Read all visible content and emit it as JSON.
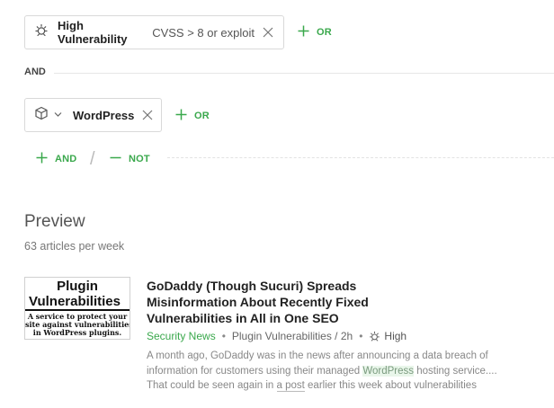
{
  "filters": {
    "row1": {
      "chip_label": "High Vulnerability",
      "chip_detail": "CVSS > 8 or exploit",
      "chip_icon": "vulnerability-icon",
      "or_label": "OR"
    },
    "and_separator": "AND",
    "row2": {
      "chip_label": "WordPress",
      "chip_icon": "cube-icon",
      "or_label": "OR"
    },
    "add_and_label": "AND",
    "add_not_label": "NOT",
    "slash": "/"
  },
  "preview": {
    "title": "Preview",
    "subtitle": "63 articles per week",
    "article": {
      "thumb_line1": "Plugin",
      "thumb_line2": "Vulnerabilities",
      "thumb_line3": "A service to protect your",
      "thumb_line4": "site against vulnerabilities",
      "thumb_line5": "in WordPress plugins.",
      "title": "GoDaddy (Though Sucuri) Spreads Misinformation About Recently Fixed Vulnerabilities in All in One SEO",
      "category": "Security News",
      "source": "Plugin Vulnerabilities / 2h",
      "severity": "High",
      "snippet_1": "A month ago, GoDaddy was in the news after announcing a data breach of information for customers using their managed ",
      "snippet_highlight": "WordPress",
      "snippet_2": " hosting service.... That could be seen again in ",
      "snippet_link": "a post",
      "snippet_3": " earlier this week about vulnerabilities"
    }
  },
  "colors": {
    "accent_green": "#3aa84c",
    "border": "#d9d9d9"
  }
}
